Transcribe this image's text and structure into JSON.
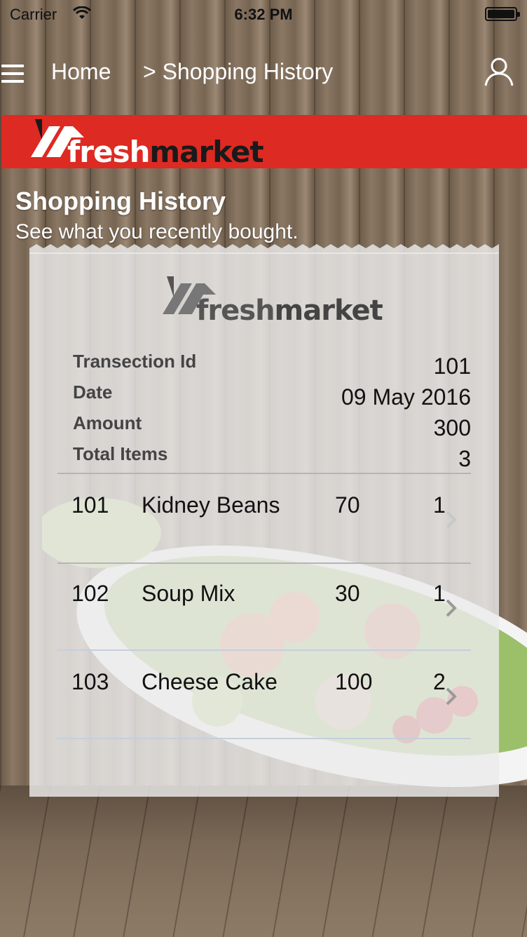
{
  "status": {
    "carrier": "Carrier",
    "time": "6:32 PM"
  },
  "nav": {
    "home": "Home",
    "current": "> Shopping History"
  },
  "brand": {
    "fresh": "fresh",
    "market": "market"
  },
  "page": {
    "title": "Shopping History",
    "subtitle": "See what you recently bought."
  },
  "receipt": {
    "fields": [
      {
        "label": "Transection Id",
        "value": "101"
      },
      {
        "label": "Date",
        "value": "09 May 2016"
      },
      {
        "label": "Amount",
        "value": "300"
      },
      {
        "label": "Total Items",
        "value": "3"
      }
    ],
    "items": [
      {
        "id": "101",
        "name": "Kidney Beans",
        "price": "70",
        "qty": "1"
      },
      {
        "id": "102",
        "name": "Soup Mix",
        "price": "30",
        "qty": "1"
      },
      {
        "id": "103",
        "name": "Cheese Cake",
        "price": "100",
        "qty": "2"
      }
    ]
  },
  "colors": {
    "brand_red": "#dd2a22"
  }
}
